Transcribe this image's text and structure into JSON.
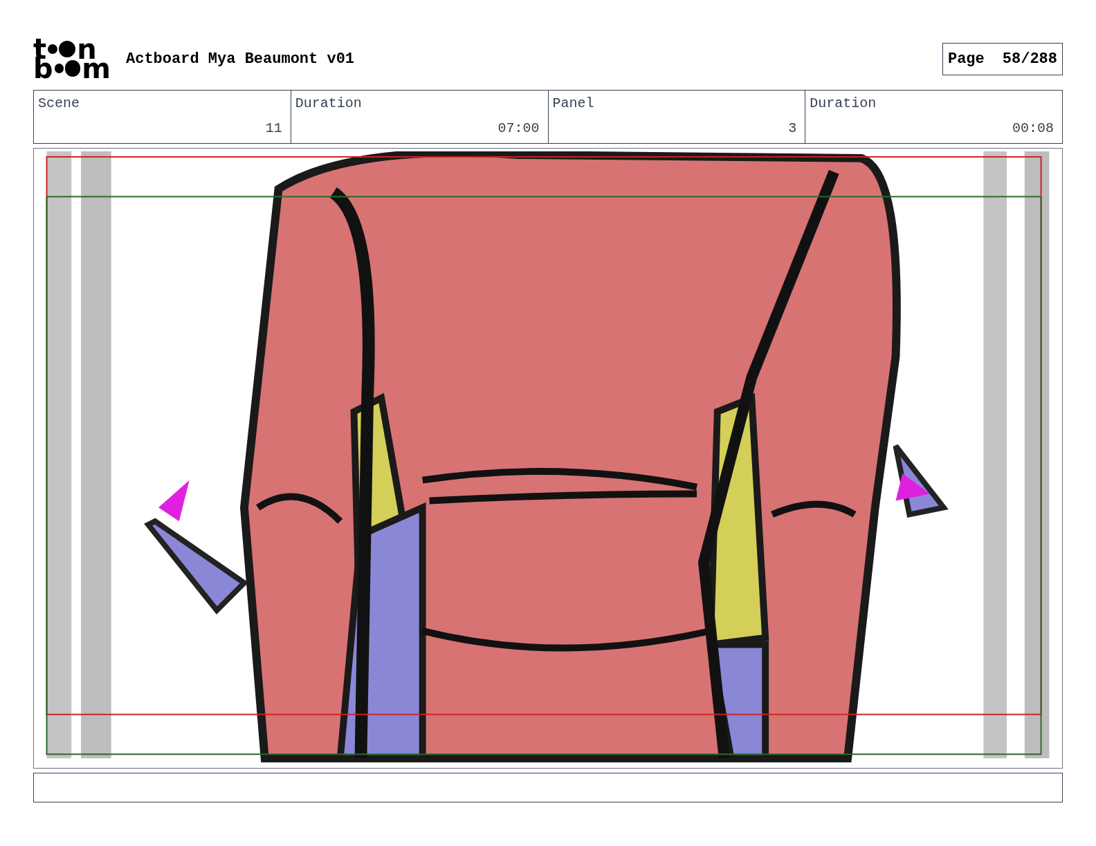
{
  "logo": {
    "line_1": [
      "t",
      "n"
    ],
    "line_2": [
      "b",
      "m"
    ]
  },
  "title": "Actboard Mya Beaumont v01",
  "page": {
    "label": "Page",
    "value": "58/288"
  },
  "fields": [
    {
      "label": "Scene",
      "value": "11"
    },
    {
      "label": "Duration",
      "value": "07:00"
    },
    {
      "label": "Panel",
      "value": "3"
    },
    {
      "label": "Duration",
      "value": "00:08"
    }
  ],
  "panel": {
    "kind": "drawing"
  }
}
